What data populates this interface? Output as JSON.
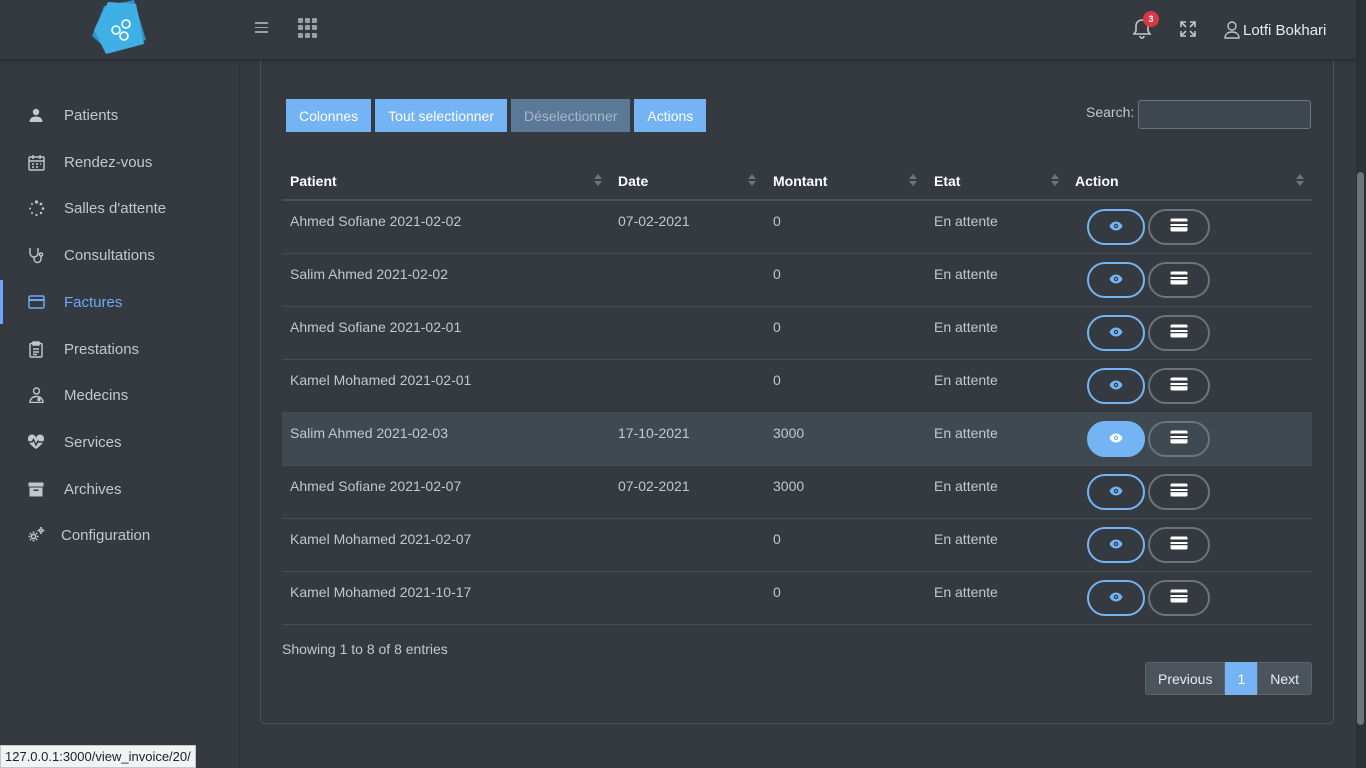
{
  "header": {
    "notifications_count": "3",
    "user_name": "Lotfi Bokhari"
  },
  "sidebar": {
    "items": [
      {
        "label": "Patients",
        "icon": "user-icon"
      },
      {
        "label": "Rendez-vous",
        "icon": "calendar-icon"
      },
      {
        "label": "Salles d'attente",
        "icon": "spinner-icon"
      },
      {
        "label": "Consultations",
        "icon": "stethoscope-icon"
      },
      {
        "label": "Factures",
        "icon": "credit-card-icon",
        "active": true
      },
      {
        "label": "Prestations",
        "icon": "clipboard-icon"
      },
      {
        "label": "Medecins",
        "icon": "doctor-icon"
      },
      {
        "label": "Services",
        "icon": "heartbeat-icon"
      },
      {
        "label": "Archives",
        "icon": "archive-icon"
      },
      {
        "label": "Configuration",
        "icon": "cogs-icon"
      }
    ]
  },
  "toolbar": {
    "buttons": [
      "Colonnes",
      "Tout selectionner",
      "Déselectionner",
      "Actions"
    ],
    "search_label": "Search:",
    "search_value": ""
  },
  "table": {
    "columns": [
      "Patient",
      "Date",
      "Montant",
      "Etat",
      "Action"
    ],
    "rows": [
      {
        "patient": "Ahmed Sofiane 2021-02-02",
        "date": "07-02-2021",
        "montant": "0",
        "etat": "En attente"
      },
      {
        "patient": "Salim Ahmed 2021-02-02",
        "date": "",
        "montant": "0",
        "etat": "En attente"
      },
      {
        "patient": "Ahmed Sofiane 2021-02-01",
        "date": "",
        "montant": "0",
        "etat": "En attente"
      },
      {
        "patient": "Kamel Mohamed 2021-02-01",
        "date": "",
        "montant": "0",
        "etat": "En attente"
      },
      {
        "patient": "Salim Ahmed 2021-02-03",
        "date": "17-10-2021",
        "montant": "3000",
        "etat": "En attente",
        "hovered": true
      },
      {
        "patient": "Ahmed Sofiane 2021-02-07",
        "date": "07-02-2021",
        "montant": "3000",
        "etat": "En attente"
      },
      {
        "patient": "Kamel Mohamed 2021-02-07",
        "date": "",
        "montant": "0",
        "etat": "En attente"
      },
      {
        "patient": "Kamel Mohamed 2021-10-17",
        "date": "",
        "montant": "0",
        "etat": "En attente"
      }
    ]
  },
  "footer": {
    "info": "Showing 1 to 8 of 8 entries",
    "previous": "Previous",
    "page": "1",
    "next": "Next"
  },
  "statusbar": {
    "url": "127.0.0.1:3000/view_invoice/20/"
  },
  "colors": {
    "accent": "#74b4f5",
    "background": "#343a40"
  }
}
